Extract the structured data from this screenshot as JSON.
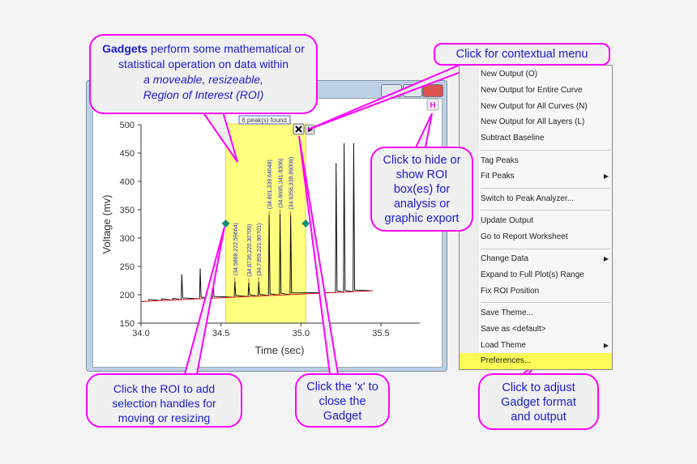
{
  "callouts": {
    "gadgets_bold": "Gadgets",
    "gadgets_rest": " perform some mathematical or statistical operation on data within",
    "gadgets_italic1": "a moveable, resizeable,",
    "gadgets_italic2": "Region of Interest (ROI)",
    "context_menu": "Click for contextual menu",
    "hide_show": "Click to hide or show ROI box(es) for analysis or graphic export",
    "roi_click": "Click the ROI to add selection handles for moving or resizing",
    "close_x": "Click the 'x' to close the Gadget",
    "preferences": "Click to adjust Gadget format and output"
  },
  "gadget": {
    "peaks_found": "6 peak(s) found",
    "close_icon": "close-icon",
    "menu_icon": "triangle-right-icon",
    "hide_label": "H"
  },
  "menu": {
    "items": [
      {
        "label": "New Output (O)"
      },
      {
        "label": "New Output for Entire Curve"
      },
      {
        "label": "New Output for All Curves (N)"
      },
      {
        "label": "New Output for All Layers (L)"
      },
      {
        "label": "Subtract Baseline",
        "sep_after": true
      },
      {
        "label": "Tag Peaks"
      },
      {
        "label": "Fit Peaks",
        "submenu": true,
        "sep_after": true
      },
      {
        "label": "Switch to Peak Analyzer...",
        "sep_after": true
      },
      {
        "label": "Update Output"
      },
      {
        "label": "Go to Report Worksheet",
        "sep_after": true
      },
      {
        "label": "Change Data",
        "submenu": true
      },
      {
        "label": "Expand to Full Plot(s) Range"
      },
      {
        "label": "Fix ROI Position",
        "sep_after": true
      },
      {
        "label": "Save Theme..."
      },
      {
        "label": "Save as <default>"
      },
      {
        "label": "Load Theme",
        "submenu": true
      },
      {
        "label": "Preferences...",
        "highlighted": true
      }
    ]
  },
  "colors": {
    "accent": "#ff00ff",
    "roi": "#ffff80",
    "highlight": "#fbfb55",
    "text_blue": "#1a1acc",
    "baseline": "#e02020"
  },
  "chart_data": {
    "type": "line",
    "xlabel": "Time (sec)",
    "ylabel": "Voltage (mv)",
    "xlim": [
      34.0,
      35.75
    ],
    "ylim": [
      150,
      500
    ],
    "xticks": [
      "34.0",
      "34.5",
      "35.0",
      "35.5"
    ],
    "yticks": [
      "150",
      "200",
      "250",
      "300",
      "350",
      "400",
      "450",
      "500"
    ],
    "roi": [
      34.53,
      35.03
    ],
    "baseline": [
      [
        34.0,
        188
      ],
      [
        35.45,
        207
      ]
    ],
    "peaks": [
      [
        34.05,
        191
      ],
      [
        34.13,
        192
      ],
      [
        34.2,
        193
      ],
      [
        34.255,
        235
      ],
      [
        34.37,
        245
      ],
      [
        34.45,
        240
      ],
      [
        34.5868,
        222.59664
      ],
      [
        34.6736,
        220.30709
      ],
      [
        34.7359,
        221.90701
      ],
      [
        34.801,
        339.64648
      ],
      [
        34.8695,
        341.8306
      ],
      [
        34.9358,
        338.89009
      ],
      [
        35.22,
        431
      ],
      [
        35.27,
        466
      ],
      [
        35.33,
        466
      ]
    ],
    "peak_labels": [
      "(34.5868,222.59664)",
      "(34.6736,220.30709)",
      "(34.7359,221.90701)",
      "(34.801,339.64648)",
      "(34.8695,341.8306)",
      "(34.9358,338.89009)"
    ],
    "grid": false
  }
}
